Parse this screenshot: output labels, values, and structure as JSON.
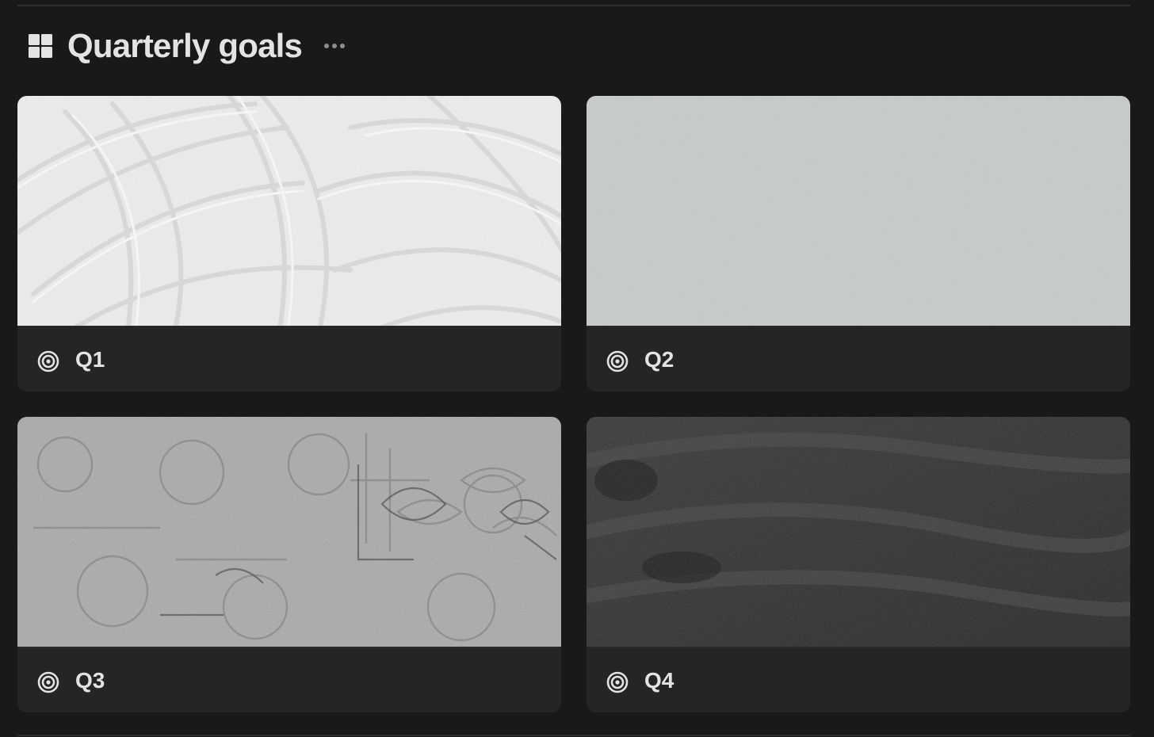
{
  "header": {
    "title": "Quarterly goals",
    "view_icon": "gallery-grid-icon",
    "more_icon": "more-horizontal-icon"
  },
  "cards": [
    {
      "label": "Q1",
      "icon": "target-icon",
      "cover": "white plaster brush-stroke texture"
    },
    {
      "label": "Q2",
      "icon": "target-icon",
      "cover": "light grey stucco texture"
    },
    {
      "label": "Q3",
      "icon": "target-icon",
      "cover": "grey patterned tile texture"
    },
    {
      "label": "Q4",
      "icon": "target-icon",
      "cover": "dark chalkboard texture"
    }
  ],
  "colors": {
    "background": "#191919",
    "card": "#252525",
    "text": "#e3e3e3",
    "muted": "#8e8e8e"
  }
}
